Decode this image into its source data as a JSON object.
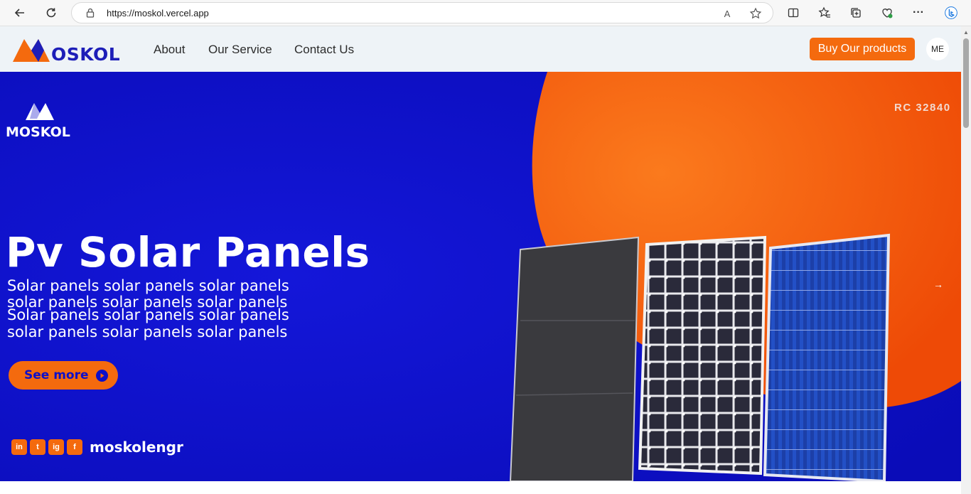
{
  "browser": {
    "url": "https://moskol.vercel.app",
    "icons": [
      "back-icon",
      "refresh-icon",
      "lock-icon",
      "read-aloud-icon",
      "favorite-star-icon",
      "split-screen-icon",
      "favorites-icon",
      "collections-icon",
      "performance-icon",
      "more-icon",
      "bing-icon"
    ],
    "read_aloud": "A",
    "more": "···"
  },
  "nav": {
    "logo_text": "MOSKOL",
    "links": [
      "About",
      "Our Service",
      "Contact Us"
    ],
    "cta": "Buy Our products",
    "avatar": "ME"
  },
  "hero": {
    "logo_text": "MOSKOL",
    "rc": "RC 32840",
    "title": "Pv Solar Panels",
    "subtitle_lines": [
      "Solar panels solar panels solar panels",
      "solar panels solar panels solar panels",
      "Solar panels solar panels solar panels",
      "solar panels solar panels solar panels"
    ],
    "see_more": "See more",
    "social_handle": "moskolengr",
    "social_icons": [
      "in",
      "t",
      "ig",
      "f"
    ],
    "prev_arrow": "←",
    "next_arrow": "→"
  },
  "colors": {
    "brand_orange": "#f46a0e",
    "hero_blue": "#0d0fc9",
    "nav_bg": "#eef3f7"
  }
}
